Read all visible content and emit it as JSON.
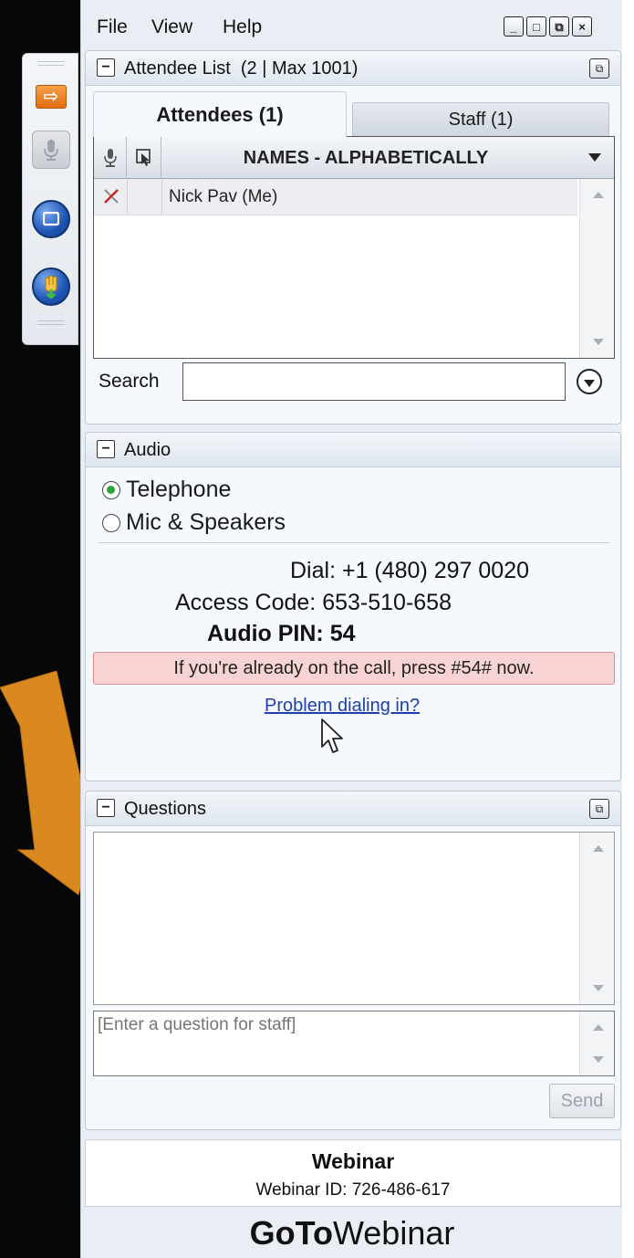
{
  "menu": {
    "file": "File",
    "view": "View",
    "help": "Help"
  },
  "window_buttons": {
    "minimize": "_",
    "maximize": "□",
    "restore": "⧉",
    "close": "×"
  },
  "attendee_list": {
    "title": "Attendee List",
    "count_text": "(2 | Max 1001)",
    "tabs": {
      "attendees": "Attendees (1)",
      "staff": "Staff (1)"
    },
    "column_header": "NAMES - ALPHABETICALLY",
    "rows": [
      {
        "name": "Nick Pav (Me)"
      }
    ],
    "search_label": "Search",
    "search_value": ""
  },
  "audio": {
    "title": "Audio",
    "options": {
      "telephone": "Telephone",
      "mic": "Mic & Speakers"
    },
    "selected": "Telephone",
    "dial_label": "Dial:",
    "dial_number": "+1 (480) 297 0020",
    "access_label": "Access Code:",
    "access_code": "653-510-658",
    "pin_label": "Audio PIN:",
    "pin_value": "54",
    "notice": "If you're already on the call, press #54# now.",
    "problem_link": "Problem dialing in?"
  },
  "questions": {
    "title": "Questions",
    "input_placeholder": "[Enter a question for staff]",
    "send_label": "Send"
  },
  "footer": {
    "title": "Webinar",
    "webinar_id": "Webinar ID: 726-486-617",
    "brand_bold": "GoTo",
    "brand_regular": "Webinar"
  },
  "colors": {
    "accent_orange": "#d9891f",
    "notice_bg": "#f8d3d3",
    "link_blue": "#1f3fae",
    "radio_selected": "#2fa33b"
  }
}
